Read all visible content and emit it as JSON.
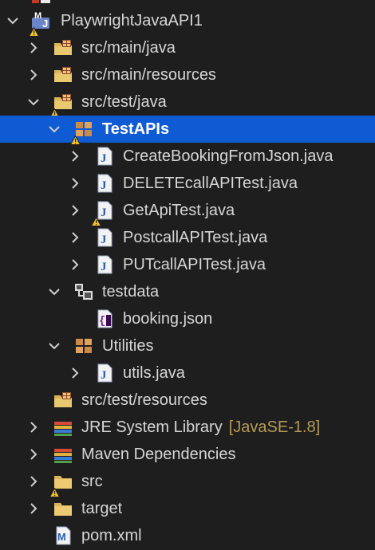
{
  "colors": {
    "selection": "#0f5bd3",
    "background": "#1e1e1e",
    "text": "#d6d6d6",
    "decoration": "#b59a55"
  },
  "tree": {
    "items": [
      {
        "label": "PlaywrightJavaAPI1",
        "icon": "maven-project-icon",
        "chevron": "down",
        "warning": true
      },
      {
        "label": "src/main/java",
        "icon": "source-folder-icon",
        "chevron": "right"
      },
      {
        "label": "src/main/resources",
        "icon": "source-folder-icon",
        "chevron": "right"
      },
      {
        "label": "src/test/java",
        "icon": "source-folder-icon",
        "chevron": "down",
        "warning": true
      },
      {
        "label": "TestAPIs",
        "icon": "package-icon",
        "chevron": "down",
        "warning": true,
        "selected": true
      },
      {
        "label": "CreateBookingFromJson.java",
        "icon": "java-file-icon",
        "chevron": "right"
      },
      {
        "label": "DELETEcallAPITest.java",
        "icon": "java-file-icon",
        "chevron": "right"
      },
      {
        "label": "GetApiTest.java",
        "icon": "java-file-icon",
        "chevron": "right",
        "warning": true
      },
      {
        "label": "PostcallAPITest.java",
        "icon": "java-file-icon",
        "chevron": "right"
      },
      {
        "label": "PUTcallAPITest.java",
        "icon": "java-file-icon",
        "chevron": "right"
      },
      {
        "label": "testdata",
        "icon": "package-folder-icon",
        "chevron": "down"
      },
      {
        "label": "booking.json",
        "icon": "json-file-icon",
        "chevron": "none"
      },
      {
        "label": "Utilities",
        "icon": "package-icon",
        "chevron": "down"
      },
      {
        "label": "utils.java",
        "icon": "java-file-icon",
        "chevron": "right"
      },
      {
        "label": "src/test/resources",
        "icon": "source-folder-icon",
        "chevron": "none"
      },
      {
        "label": "JRE System Library",
        "extra": "[JavaSE-1.8]",
        "icon": "library-icon",
        "chevron": "right"
      },
      {
        "label": "Maven Dependencies",
        "icon": "library-icon",
        "chevron": "right"
      },
      {
        "label": "src",
        "icon": "folder-icon",
        "chevron": "right",
        "warning": true
      },
      {
        "label": "target",
        "icon": "folder-icon",
        "chevron": "right"
      },
      {
        "label": "pom.xml",
        "icon": "maven-pom-icon",
        "chevron": "none"
      }
    ]
  }
}
